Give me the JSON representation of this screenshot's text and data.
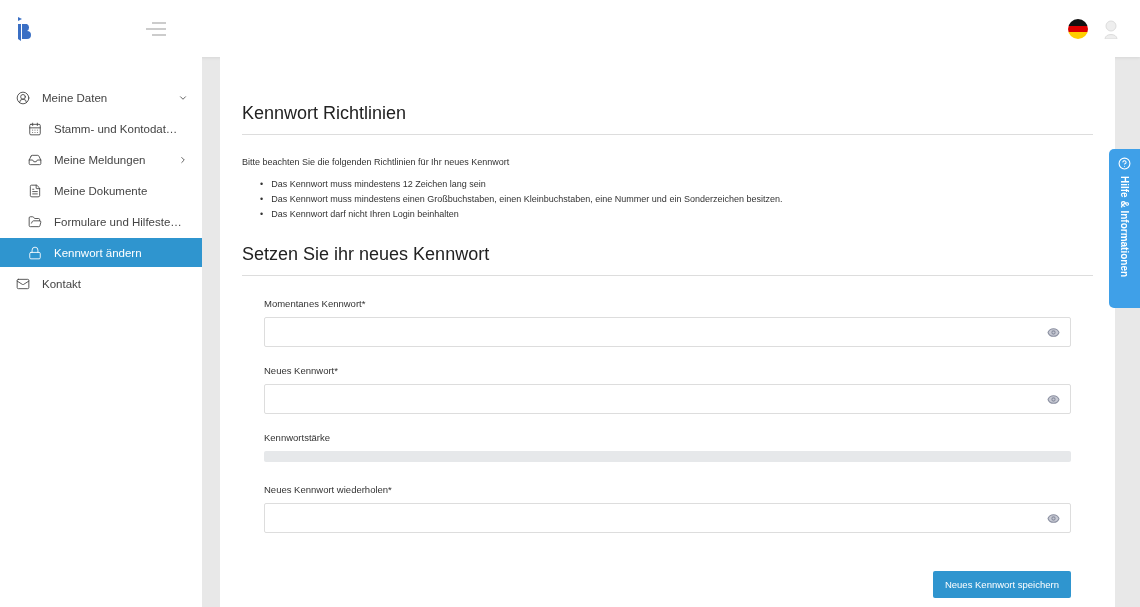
{
  "sidebar": {
    "items": [
      {
        "label": "Meine Daten",
        "expanded": true,
        "selected": false,
        "children": [
          {
            "label": "Stamm- und Kontodat…",
            "selected": false,
            "has_submenu": false
          },
          {
            "label": "Meine Meldungen",
            "selected": false,
            "has_submenu": true
          },
          {
            "label": "Meine Dokumente",
            "selected": false,
            "has_submenu": false
          },
          {
            "label": "Formulare und Hilfeste…",
            "selected": false,
            "has_submenu": false
          },
          {
            "label": "Kennwort ändern",
            "selected": true,
            "has_submenu": false
          }
        ]
      },
      {
        "label": "Kontakt",
        "selected": false
      }
    ]
  },
  "help_tab": {
    "label": "Hilfe & Informationen"
  },
  "policy": {
    "title": "Kennwort Richtlinien",
    "intro": "Bitte beachten Sie die folgenden Richtlinien für Ihr neues Kennwort",
    "rules": [
      {
        "bullet": "•",
        "text": "Das Kennwort muss mindestens 12 Zeichen lang sein"
      },
      {
        "bullet": "•",
        "text": "Das Kennwort muss mindestens einen Großbuchstaben, einen Kleinbuchstaben, eine Nummer und ein Sonderzeichen besitzen."
      },
      {
        "bullet": "•",
        "text": "Das Kennwort darf nicht Ihren Login beinhalten"
      }
    ]
  },
  "form": {
    "title": "Setzen Sie ihr neues Kennwort",
    "fields": [
      {
        "kind": "password",
        "label": "Momentanes Kennwort*"
      },
      {
        "kind": "password",
        "label": "Neues Kennwort*"
      },
      {
        "kind": "meter",
        "label": "Kennwortstärke"
      },
      {
        "kind": "password",
        "label": "Neues Kennwort wiederholen*"
      }
    ],
    "submit": "Neues Kennwort speichern"
  }
}
